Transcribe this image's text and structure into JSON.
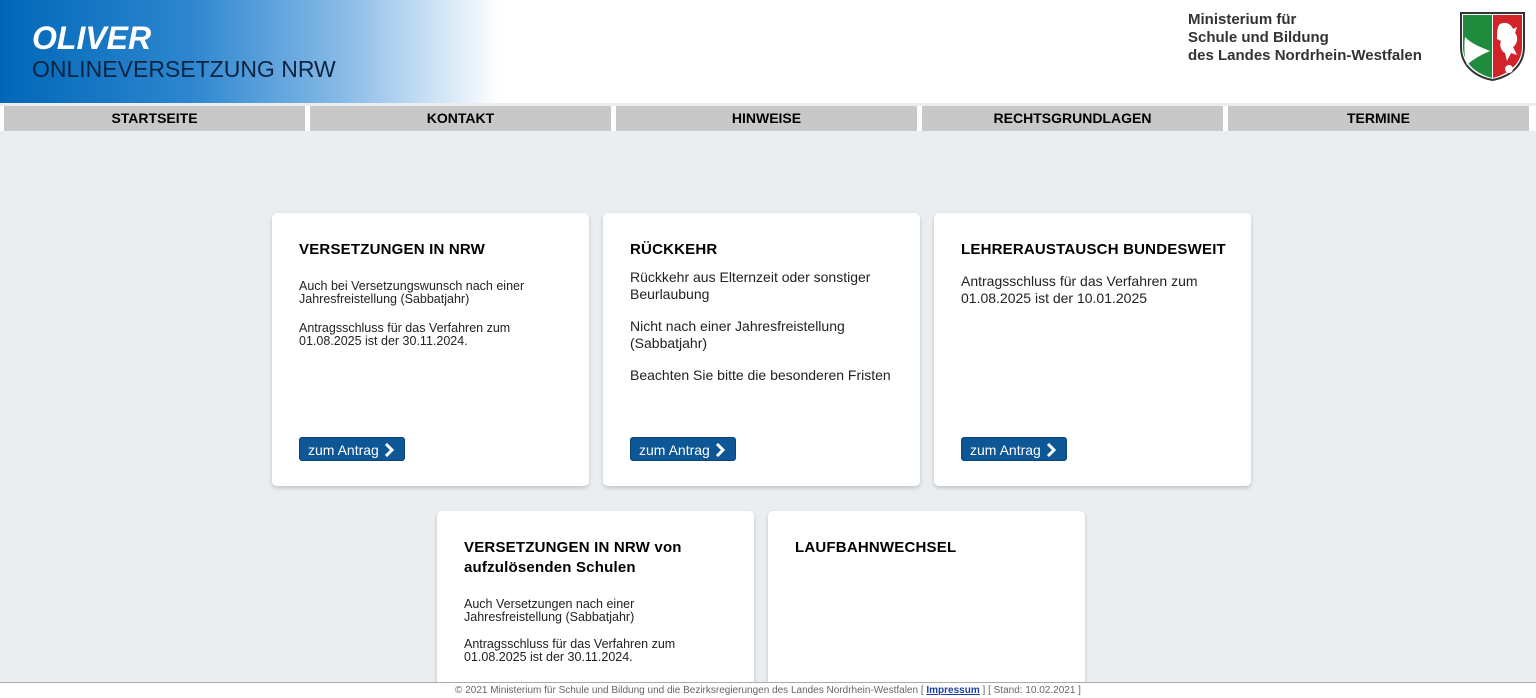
{
  "header": {
    "title": "OLIVER",
    "subtitle": "ONLINEVERSETZUNG NRW",
    "ministry": [
      "Ministerium für",
      "Schule und Bildung",
      "des Landes Nordrhein-Westfalen"
    ]
  },
  "nav": [
    {
      "label": "STARTSEITE"
    },
    {
      "label": "KONTAKT"
    },
    {
      "label": "HINWEISE"
    },
    {
      "label": "RECHTSGRUNDLAGEN"
    },
    {
      "label": "TERMINE"
    }
  ],
  "cards": [
    {
      "title": "VERSETZUNGEN IN NRW",
      "p1": "Auch bei Versetzungswunsch nach einer Jahresfreistellung (Sabbatjahr)",
      "p2": "Antragsschluss für das Verfahren zum 01.08.2025 ist der 30.11.2024.",
      "button": "zum Antrag"
    },
    {
      "title": "RÜCKKEHR",
      "p1": "Rückkehr aus Elternzeit oder sonstiger Beurlaubung",
      "p2": "Nicht nach einer Jahresfreistellung (Sabbatjahr)",
      "p3": "Beachten Sie bitte die besonderen Fristen",
      "button": "zum Antrag"
    },
    {
      "title": "LEHRERAUSTAUSCH BUNDESWEIT",
      "p1": "Antragsschluss für das Verfahren zum 01.08.2025 ist der 10.01.2025",
      "button": "zum Antrag"
    },
    {
      "title": "VERSETZUNGEN IN NRW von aufzulösenden Schulen",
      "p1": "Auch Versetzungen nach einer Jahresfreistellung (Sabbatjahr)",
      "p2": "Antragsschluss für das Verfahren zum 01.08.2025 ist der 30.11.2024."
    },
    {
      "title": "LAUFBAHNWECHSEL"
    }
  ],
  "footer": {
    "prefix": "© 2021 Ministerium für Schule und Bildung und die Bezirksregierungen des Landes Nordrhein-Westfalen [ ",
    "link": "Impressum",
    "suffix": " ] [ Stand: 10.02.2021 ]"
  },
  "colors": {
    "brand_blue": "#0067b8",
    "button_blue": "#0d5796",
    "nav_gray": "#c8c8c8",
    "page_bg": "#eaeef1",
    "crest_green": "#1e8c3c",
    "crest_red": "#d2232a"
  },
  "icons": {
    "crest": "nrw-coat-of-arms-icon",
    "button": "chevron-right-icon"
  }
}
